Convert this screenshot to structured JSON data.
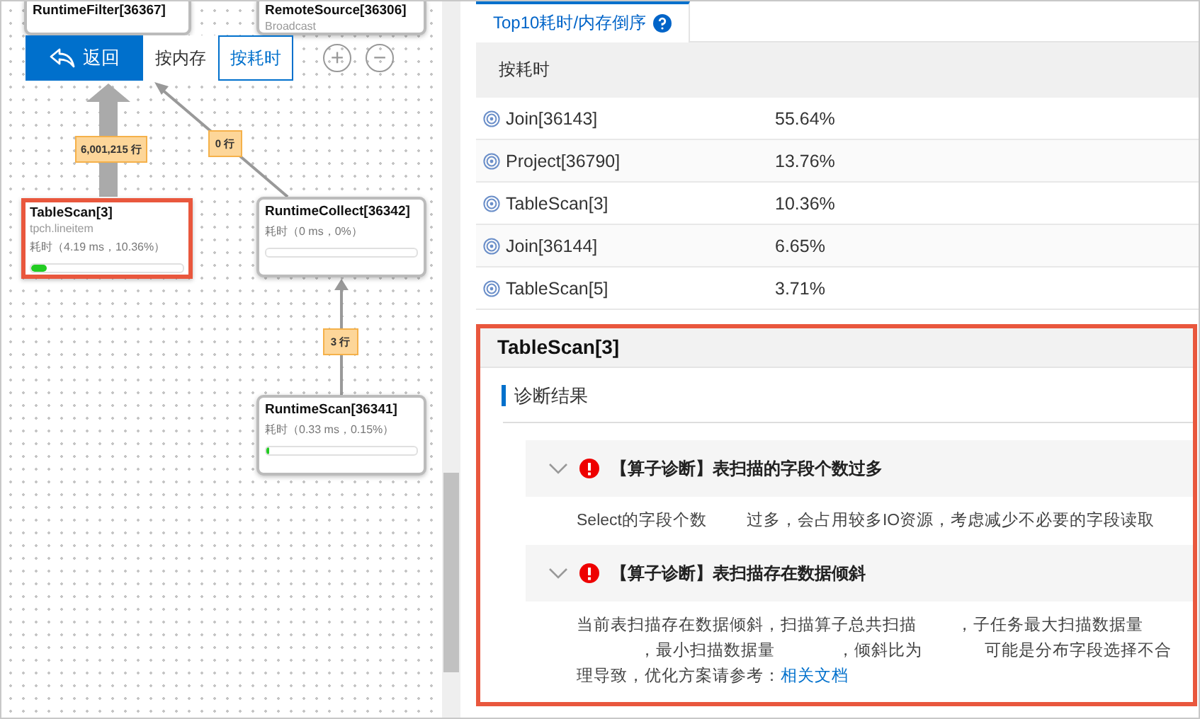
{
  "toolbar": {
    "back": "返回",
    "modes": [
      {
        "label": "按内存",
        "selected": false
      },
      {
        "label": "按耗时",
        "selected": true
      }
    ],
    "zoom": [
      "+",
      "−"
    ]
  },
  "graph": {
    "nodes": [
      {
        "title": "RuntimeFilter[36367]",
        "selected": false
      },
      {
        "title": "RemoteSource[36306]",
        "subtitle": "Broadcast",
        "selected": false
      },
      {
        "title": "TableScan[3]",
        "subtitle": "tpch.lineitem",
        "time": "耗时（4.19 ms，10.36%）",
        "level": 0.1,
        "selected": true
      },
      {
        "title": "RuntimeCollect[36342]",
        "time": "耗时（0 ms，0%）",
        "level": 0,
        "selected": false
      },
      {
        "title": "RuntimeScan[36341]",
        "time": "耗时（0.33 ms，0.15%）",
        "level": 0.015,
        "selected": false
      }
    ],
    "edges": [
      {
        "label": "6,001,215 行",
        "kind": "heavy"
      },
      {
        "label": "0 行",
        "kind": "light"
      },
      {
        "label": "3 行",
        "kind": "light"
      }
    ]
  },
  "tab": {
    "label": "Top10耗时/内存倒序",
    "selected": true
  },
  "table": {
    "header": "按耗时",
    "rows": [
      {
        "name": "Join[36143]",
        "value": "55.64%"
      },
      {
        "name": "Project[36790]",
        "value": "13.76%"
      },
      {
        "name": "TableScan[3]",
        "value": "10.36%"
      },
      {
        "name": "Join[36144]",
        "value": "6.65%"
      },
      {
        "name": "TableScan[5]",
        "value": "3.71%"
      }
    ]
  },
  "detail": {
    "title": "TableScan[3]",
    "section": "诊断结果",
    "items": [
      {
        "title": "【算子诊断】表扫描的字段个数过多",
        "expanded": true,
        "parts": [
          "Select的字段个数",
          "过多，会占用较多IO资源，考虑减少不必要的字段读取"
        ]
      },
      {
        "title": "【算子诊断】表扫描存在数据倾斜",
        "expanded": true,
        "parts": [
          "当前表扫描存在数据倾斜，扫描算子总共扫描",
          "，子任务最大扫描数据量",
          "，最小扫描数据量",
          "，倾斜比为",
          "可能是分布字段选择不合理导致，优化方案请参考："
        ],
        "link": "相关文档"
      }
    ]
  }
}
